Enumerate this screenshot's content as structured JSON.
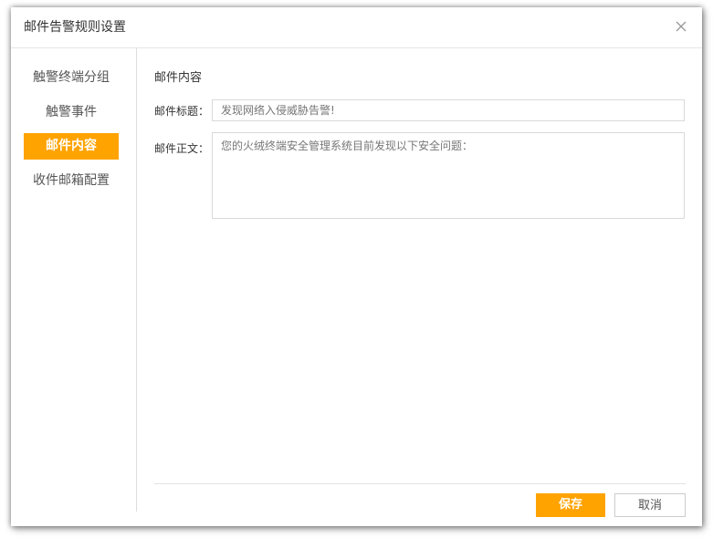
{
  "dialog": {
    "title": "邮件告警规则设置"
  },
  "sidebar": {
    "items": [
      {
        "label": "触警终端分组",
        "active": false
      },
      {
        "label": "触警事件",
        "active": false
      },
      {
        "label": "邮件内容",
        "active": true
      },
      {
        "label": "收件邮箱配置",
        "active": false
      }
    ]
  },
  "content": {
    "section_title": "邮件内容",
    "subject_label": "邮件标题：",
    "subject_value": "发现网络入侵威胁告警!",
    "body_label": "邮件正文：",
    "body_value": "您的火绒终端安全管理系统目前发现以下安全问题："
  },
  "footer": {
    "save_label": "保存",
    "cancel_label": "取消"
  },
  "colors": {
    "accent": "#ffa300"
  }
}
